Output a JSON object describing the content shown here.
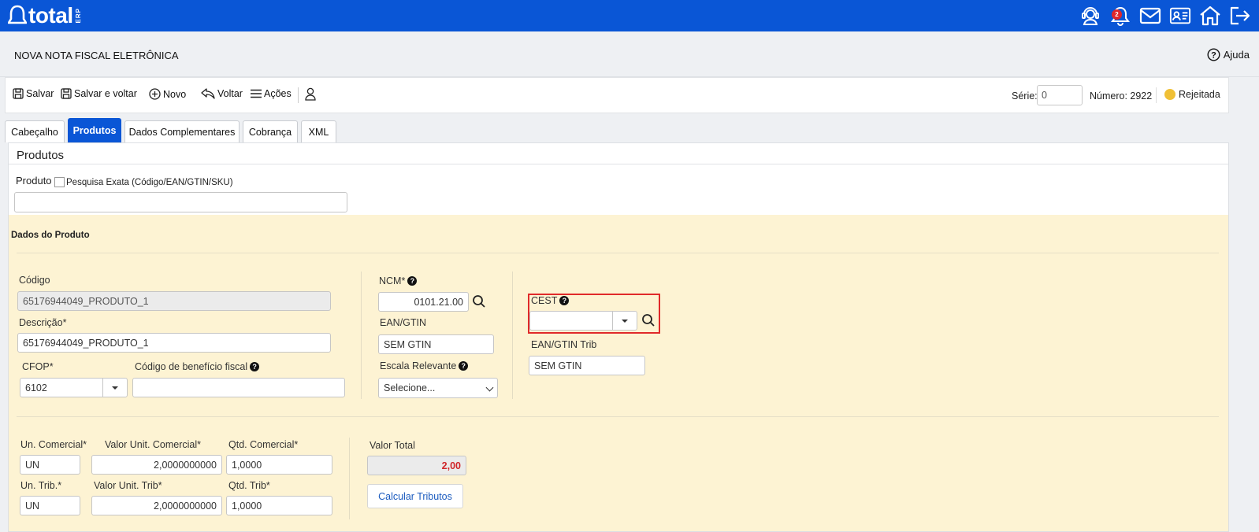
{
  "app": {
    "logo_text": "total",
    "logo_sub": "ERP",
    "notifications_count": "2"
  },
  "page": {
    "title": "NOVA NOTA FISCAL ELETRÔNICA",
    "help_label": "Ajuda"
  },
  "toolbar": {
    "save_label": "Salvar",
    "save_back_label": "Salvar e voltar",
    "new_label": "Novo",
    "back_label": "Voltar",
    "actions_label": "Ações",
    "serie_label": "Série:",
    "serie_value": "0",
    "numero_label": "Número: 2922",
    "status_label": "Rejeitada",
    "status_color": "#f0c036"
  },
  "tabs": [
    {
      "label": "Cabeçalho"
    },
    {
      "label": "Produtos",
      "active": true
    },
    {
      "label": "Dados Complementares"
    },
    {
      "label": "Cobrança"
    },
    {
      "label": "XML"
    }
  ],
  "produtos": {
    "section_title": "Produtos",
    "produto_label": "Produto",
    "exact_search_label": "Pesquisa Exata (Código/EAN/GTIN/SKU)",
    "produto_value": ""
  },
  "dados": {
    "title": "Dados do Produto",
    "codigo_label": "Código",
    "codigo_value": "65176944049_PRODUTO_1",
    "descricao_label": "Descrição*",
    "descricao_value": "65176944049_PRODUTO_1",
    "cfop_label": "CFOP*",
    "cfop_value": "6102",
    "beneficio_label": "Código de benefício fiscal",
    "beneficio_value": "",
    "ncm_label": "NCM*",
    "ncm_value": "0101.21.00",
    "ean_label": "EAN/GTIN",
    "ean_value": "SEM GTIN",
    "escala_label": "Escala Relevante",
    "escala_value": "Selecione...",
    "cest_label": "CEST",
    "cest_value": "",
    "ean_trib_label": "EAN/GTIN Trib",
    "ean_trib_value": "SEM GTIN",
    "un_com_label": "Un. Comercial*",
    "un_com_value": "UN",
    "vl_unit_com_label": "Valor Unit. Comercial*",
    "vl_unit_com_value": "2,0000000000",
    "qtd_com_label": "Qtd. Comercial*",
    "qtd_com_value": "1,0000",
    "un_trib_label": "Un. Trib.*",
    "un_trib_value": "UN",
    "vl_unit_trib_label": "Valor Unit. Trib*",
    "vl_unit_trib_value": "2,0000000000",
    "qtd_trib_label": "Qtd. Trib*",
    "qtd_trib_value": "1,0000",
    "valor_total_label": "Valor Total",
    "valor_total_value": "2,00",
    "calc_button_label": "Calcular Tributos"
  }
}
